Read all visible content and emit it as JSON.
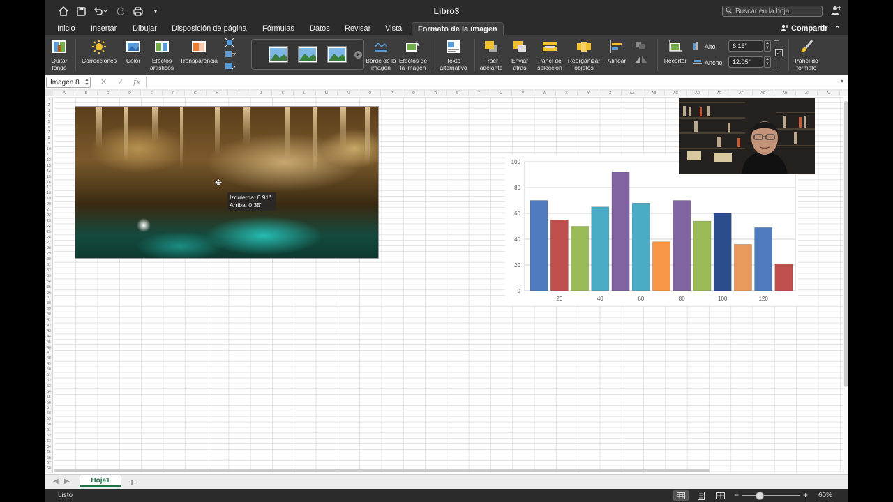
{
  "window": {
    "title": "Libro3",
    "search_placeholder": "Buscar en la hoja"
  },
  "tabs": [
    "Inicio",
    "Insertar",
    "Dibujar",
    "Disposición de página",
    "Fórmulas",
    "Datos",
    "Revisar",
    "Vista",
    "Formato de la imagen"
  ],
  "active_tab": "Formato de la imagen",
  "share_label": "Compartir",
  "ribbon": {
    "quitar_fondo": "Quitar fondo",
    "correcciones": "Correcciones",
    "color": "Color",
    "efectos_artisticos": "Efectos artísticos",
    "transparencia": "Transparencia",
    "borde": "Borde de la imagen",
    "efectos": "Efectos de la imagen",
    "texto_alt": "Texto alternativo",
    "traer": "Traer adelante",
    "enviar": "Enviar atrás",
    "panel_sel": "Panel de selección",
    "reorganizar": "Reorganizar objetos",
    "alinear": "Alinear",
    "recortar": "Recortar",
    "alto_label": "Alto:",
    "alto_value": "6.16\"",
    "ancho_label": "Ancho:",
    "ancho_value": "12.05\"",
    "panel_formato": "Panel de formato"
  },
  "formula_bar": {
    "name_box": "Imagen 8",
    "fx": "fx"
  },
  "columns": [
    "A",
    "B",
    "C",
    "D",
    "E",
    "F",
    "G",
    "H",
    "I",
    "J",
    "K",
    "L",
    "M",
    "N",
    "O",
    "P",
    "Q",
    "R",
    "S",
    "T",
    "U",
    "V",
    "W",
    "X",
    "Y",
    "Z",
    "AA",
    "AB",
    "AC",
    "AD",
    "AE",
    "AF",
    "AG",
    "AH",
    "AI",
    "AJ"
  ],
  "row_count": 68,
  "tooltip": {
    "left": "Izquierda: 0.91\"",
    "top": "Arriba: 0.35\""
  },
  "chart_data": {
    "type": "bar",
    "categories": [
      "",
      "20",
      "",
      "40",
      "",
      "60",
      "",
      "80",
      "",
      "100",
      "",
      "120"
    ],
    "x_ticks": [
      "20",
      "40",
      "60",
      "80",
      "100",
      "120"
    ],
    "values": [
      70,
      55,
      50,
      65,
      92,
      68,
      38,
      70,
      54,
      60,
      36,
      49,
      21
    ],
    "colors": [
      "#4f7bbf",
      "#c0504d",
      "#9bbb59",
      "#4bacc6",
      "#8064a2",
      "#4bacc6",
      "#f79646",
      "#8064a2",
      "#9bbb59",
      "#2c4d8c",
      "#e8995c",
      "#4f7bbf",
      "#c0504d"
    ],
    "ylim": [
      0,
      100
    ],
    "y_ticks": [
      "0",
      "20",
      "40",
      "60",
      "80",
      "100"
    ],
    "grid": true
  },
  "sheet_tab": "Hoja1",
  "status": {
    "text": "Listo",
    "zoom": "60%"
  }
}
